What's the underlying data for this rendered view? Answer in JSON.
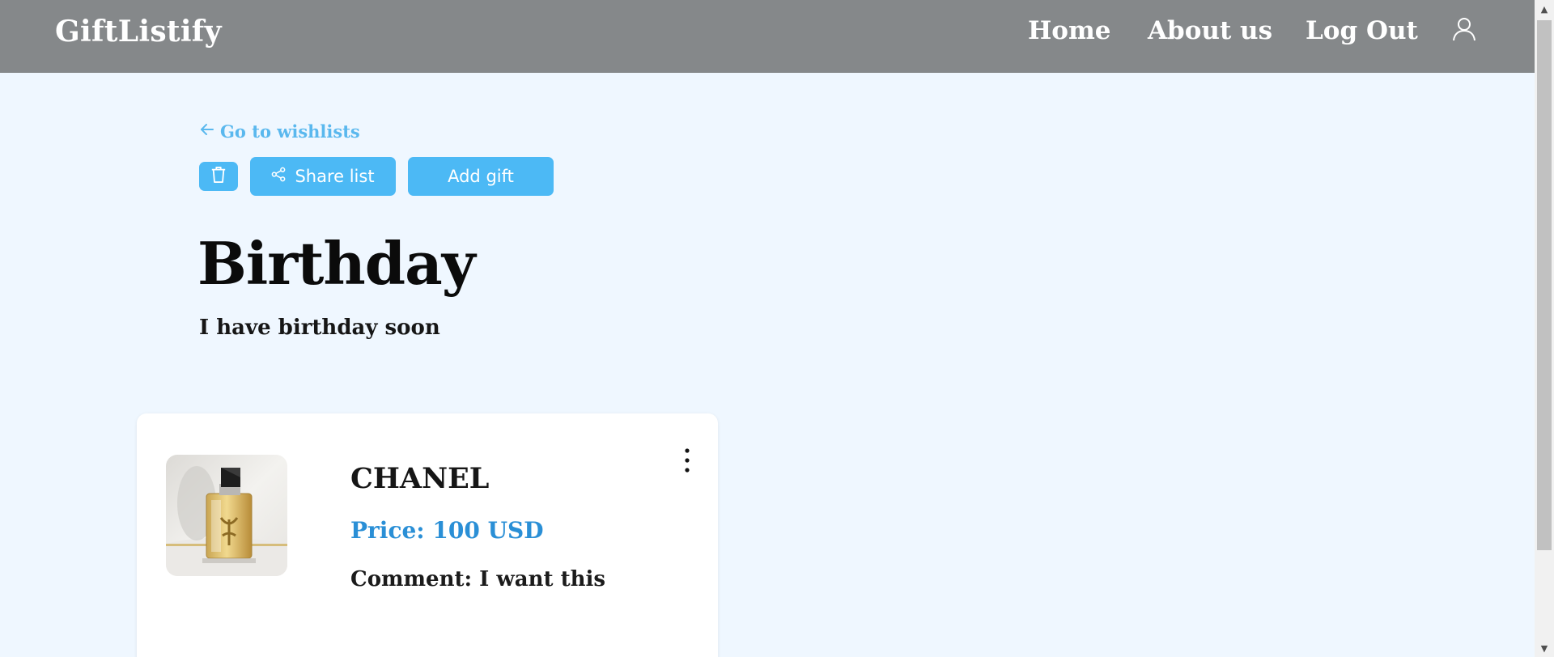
{
  "header": {
    "brand": "GiftListify",
    "nav": {
      "home": "Home",
      "about": "About us",
      "logout": "Log Out"
    },
    "user_icon": "user-icon"
  },
  "wishlist": {
    "back_link": "Go to wishlists",
    "actions": {
      "delete_icon": "trash-icon",
      "share_label": "Share list",
      "add_label": "Add gift"
    },
    "title": "Birthday",
    "description": "I have birthday soon"
  },
  "gifts": [
    {
      "name": "CHANEL",
      "price": "Price: 100 USD",
      "comment": "Comment: I want this",
      "image_icon": "perfume-bottle-image",
      "menu_icon": "more-vertical-icon"
    }
  ],
  "colors": {
    "header_bg": "#85888a",
    "page_bg": "#eff7ff",
    "accent": "#4cb9f5",
    "price": "#2a8fd6",
    "link": "#5ab8ee"
  }
}
